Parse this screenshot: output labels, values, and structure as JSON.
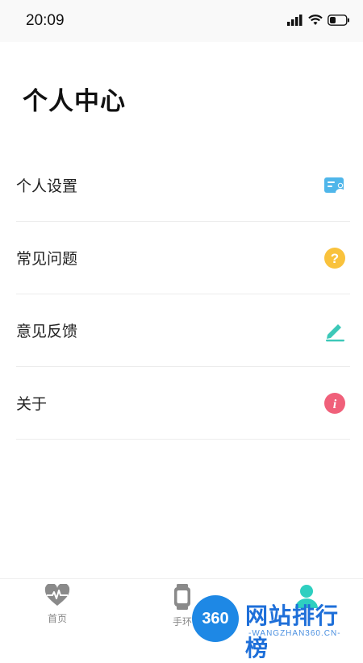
{
  "status_bar": {
    "time": "20:09"
  },
  "page": {
    "title": "个人中心"
  },
  "menu": {
    "items": [
      {
        "label": "个人设置",
        "icon": "profile-card-icon",
        "color": "#4fb6ea"
      },
      {
        "label": "常见问题",
        "icon": "question-icon",
        "color": "#f9c23c"
      },
      {
        "label": "意见反馈",
        "icon": "edit-pencil-icon",
        "color": "#3cc8b8"
      },
      {
        "label": "关于",
        "icon": "info-icon",
        "color": "#f0607a"
      }
    ]
  },
  "tab_bar": {
    "tabs": [
      {
        "label": "首页",
        "icon": "heartbeat-icon",
        "active": false
      },
      {
        "label": "手环",
        "icon": "watch-icon",
        "active": false
      },
      {
        "label": "",
        "icon": "user-icon",
        "active": true,
        "color": "#2ecfc0"
      }
    ]
  },
  "watermark": {
    "badge": "360",
    "title": "网站排行榜",
    "subtitle": "-WANGZHAN360.CN-"
  }
}
